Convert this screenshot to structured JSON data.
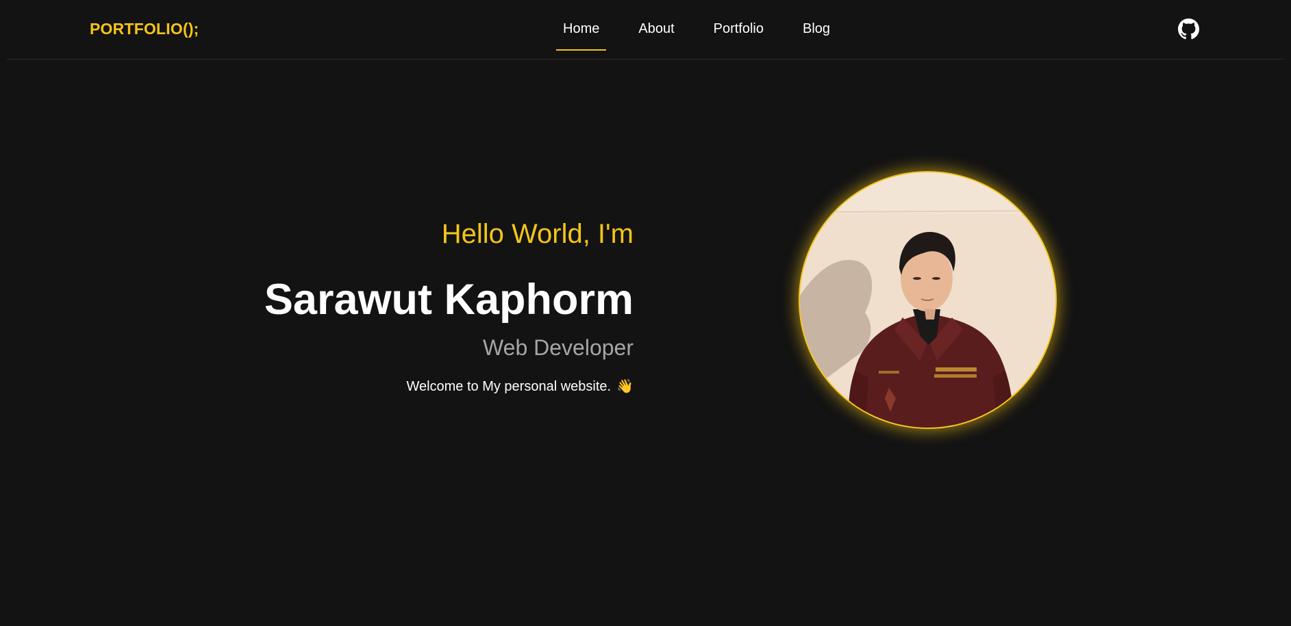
{
  "header": {
    "logo": "PORTFOLIO();",
    "nav": [
      {
        "label": "Home",
        "active": true
      },
      {
        "label": "About",
        "active": false
      },
      {
        "label": "Portfolio",
        "active": false
      },
      {
        "label": "Blog",
        "active": false
      }
    ],
    "github_icon": "github-icon"
  },
  "hero": {
    "greeting": "Hello World, I'm",
    "name": "Sarawut Kaphorm",
    "role": "Web Developer",
    "welcome": "Welcome to My personal website.",
    "wave_emoji": "👋",
    "avatar_icon": "profile-photo"
  },
  "colors": {
    "background": "#131313",
    "accent": "#f5c518",
    "text": "#ffffff",
    "muted": "#a6a6a6"
  }
}
